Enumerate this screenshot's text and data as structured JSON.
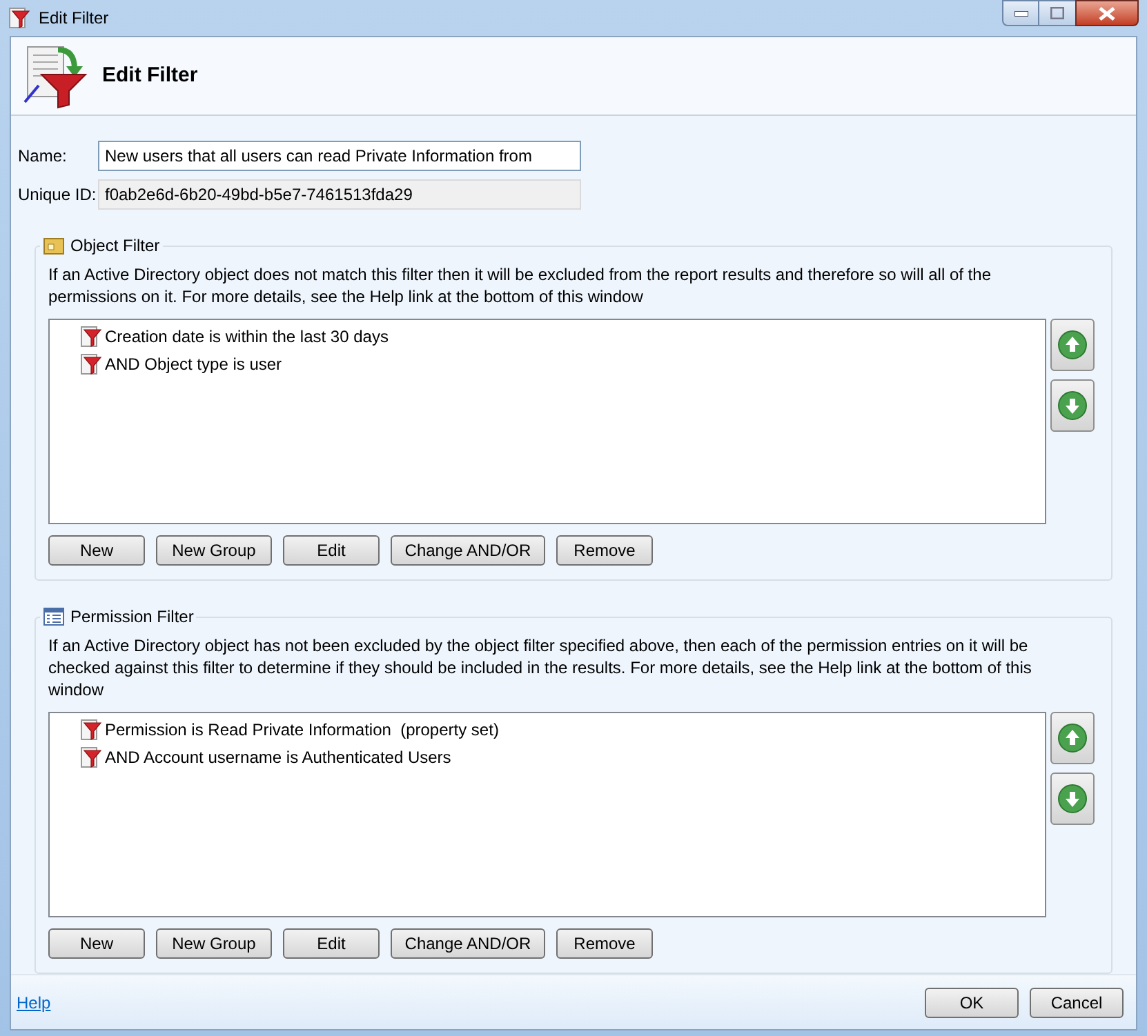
{
  "window": {
    "title": "Edit Filter"
  },
  "header": {
    "title": "Edit Filter"
  },
  "fields": [
    {
      "label": "Name:",
      "value": "New users that all users can read Private Information from",
      "disabled": false
    },
    {
      "label": "Unique ID:",
      "value": "f0ab2e6d-6b20-49bd-b5e7-7461513fda29",
      "disabled": true
    }
  ],
  "sections": [
    {
      "title": "Object Filter",
      "kind": "folder",
      "description": "If an Active Directory object does not match this filter then it will be excluded from the report results and therefore so will all of the permissions on it. For more details, see the Help link at the bottom of this window",
      "items": [
        "Creation date is within the last 30 days",
        "AND Object type is user"
      ],
      "buttons": [
        "New",
        "New Group",
        "Edit",
        "Change AND/OR",
        "Remove"
      ]
    },
    {
      "title": "Permission Filter",
      "kind": "list",
      "description": "If an Active Directory object has not been excluded by the object filter specified above, then each of the permission entries on it will be checked against this filter to determine if they should be included in the results. For more details, see the Help link at the bottom of this window",
      "items": [
        "Permission is Read Private Information  (property set)",
        "AND Account username is Authenticated Users"
      ],
      "buttons": [
        "New",
        "New Group",
        "Edit",
        "Change AND/OR",
        "Remove"
      ]
    }
  ],
  "footer": {
    "link": "Help",
    "buttons": [
      "OK",
      "Cancel"
    ]
  }
}
